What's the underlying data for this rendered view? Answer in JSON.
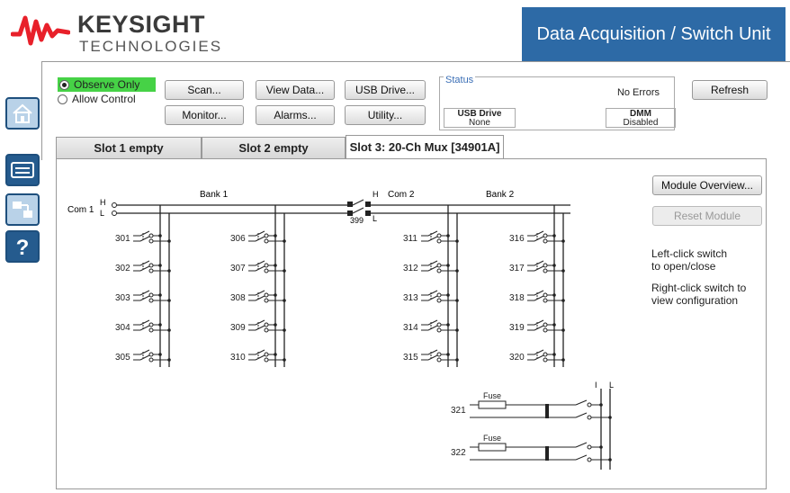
{
  "brand": {
    "name": "KEYSIGHT",
    "sub": "TECHNOLOGIES",
    "color": "#e8202a"
  },
  "app_title": "Data Acquisition / Switch Unit",
  "mode": {
    "observe": "Observe Only",
    "allow": "Allow Control"
  },
  "toolbar": {
    "scan": "Scan...",
    "monitor": "Monitor...",
    "view_data": "View Data...",
    "alarms": "Alarms...",
    "usb_drive": "USB Drive...",
    "utility": "Utility...",
    "refresh": "Refresh"
  },
  "status": {
    "legend": "Status",
    "errors": "No Errors",
    "usb_label": "USB Drive",
    "usb_value": "None",
    "dmm_label": "DMM",
    "dmm_value": "Disabled"
  },
  "tabs": [
    "Slot 1 empty",
    "Slot 2 empty",
    "Slot 3:  20-Ch Mux [34901A]"
  ],
  "module": {
    "overview": "Module Overview...",
    "reset": "Reset Module",
    "hint1": "Left-click switch\nto open/close",
    "hint2": "Right-click switch to\nview configuration"
  },
  "diagram": {
    "com1": "Com 1",
    "com2": "Com 2",
    "bank1": "Bank 1",
    "bank2": "Bank 2",
    "h": "H",
    "l": "L",
    "i": "I",
    "sep_switch": "399",
    "fuse": "Fuse",
    "bank1_cols": [
      [
        "301",
        "302",
        "303",
        "304",
        "305"
      ],
      [
        "306",
        "307",
        "308",
        "309",
        "310"
      ]
    ],
    "bank2_cols": [
      [
        "311",
        "312",
        "313",
        "314",
        "315"
      ],
      [
        "316",
        "317",
        "318",
        "319",
        "320"
      ]
    ],
    "current_channels": [
      "321",
      "322"
    ]
  },
  "colors": {
    "accent": "#2d6aa6",
    "selected": "#46d246"
  },
  "icons": [
    "home-icon",
    "module-icon",
    "scan-list-icon",
    "help-icon"
  ]
}
